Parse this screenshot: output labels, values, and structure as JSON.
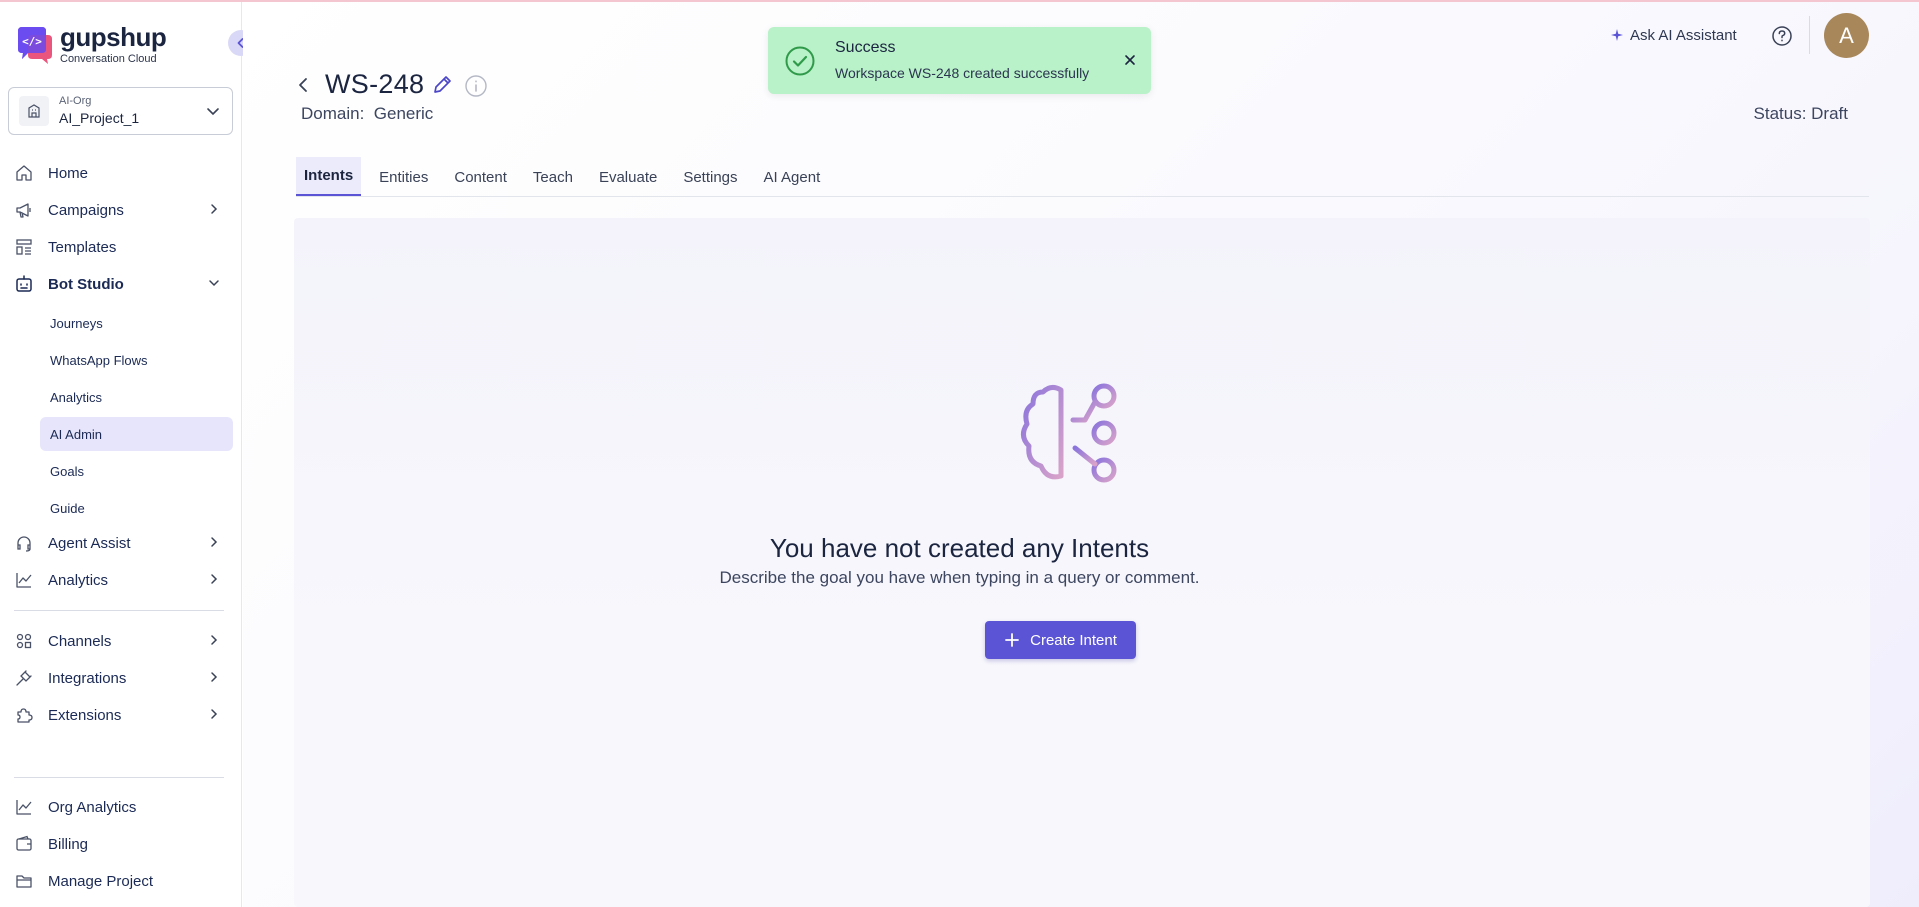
{
  "brand": {
    "name": "gupshup",
    "subtitle": "Conversation Cloud"
  },
  "project": {
    "org": "AI-Org",
    "name": "AI_Project_1"
  },
  "nav": {
    "home": "Home",
    "campaigns": "Campaigns",
    "templates": "Templates",
    "bot_studio": "Bot Studio",
    "bot_studio_items": [
      "Journeys",
      "WhatsApp Flows",
      "Analytics",
      "AI Admin",
      "Goals",
      "Guide"
    ],
    "agent_assist": "Agent Assist",
    "analytics": "Analytics",
    "channels": "Channels",
    "integrations": "Integrations",
    "extensions": "Extensions",
    "org_analytics": "Org Analytics",
    "billing": "Billing",
    "manage_project": "Manage Project"
  },
  "workspace": {
    "title": "WS-248",
    "domain_label": "Domain:",
    "domain_value": "Generic",
    "status": "Status: Draft"
  },
  "tabs": [
    "Intents",
    "Entities",
    "Content",
    "Teach",
    "Evaluate",
    "Settings",
    "AI Agent"
  ],
  "empty_state": {
    "title": "You have not created any Intents",
    "subtitle": "Describe the goal you have when typing in a query or comment.",
    "button": "Create Intent"
  },
  "toast": {
    "title": "Success",
    "message": "Workspace WS-248 created successfully"
  },
  "header": {
    "ask_ai": "Ask AI Assistant",
    "avatar_initial": "A"
  },
  "colors": {
    "accent": "#5b55d6",
    "toast_bg": "#b9f1c8",
    "active_nav_bg": "#e6e5fb",
    "avatar_bg": "#a8875a"
  }
}
